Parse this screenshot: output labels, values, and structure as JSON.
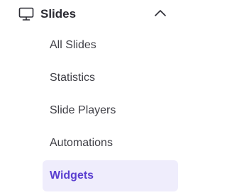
{
  "section": {
    "title": "Slides",
    "icon": "monitor-icon",
    "toggle_icon": "chevron-up-icon",
    "expanded": true
  },
  "items": [
    {
      "label": "All Slides",
      "active": false
    },
    {
      "label": "Statistics",
      "active": false
    },
    {
      "label": "Slide Players",
      "active": false
    },
    {
      "label": "Automations",
      "active": false
    },
    {
      "label": "Widgets",
      "active": true
    }
  ],
  "colors": {
    "text": "#2b2b33",
    "sub_text": "#3f3f46",
    "active_bg": "#efedfc",
    "active_text": "#5a3fd0"
  }
}
